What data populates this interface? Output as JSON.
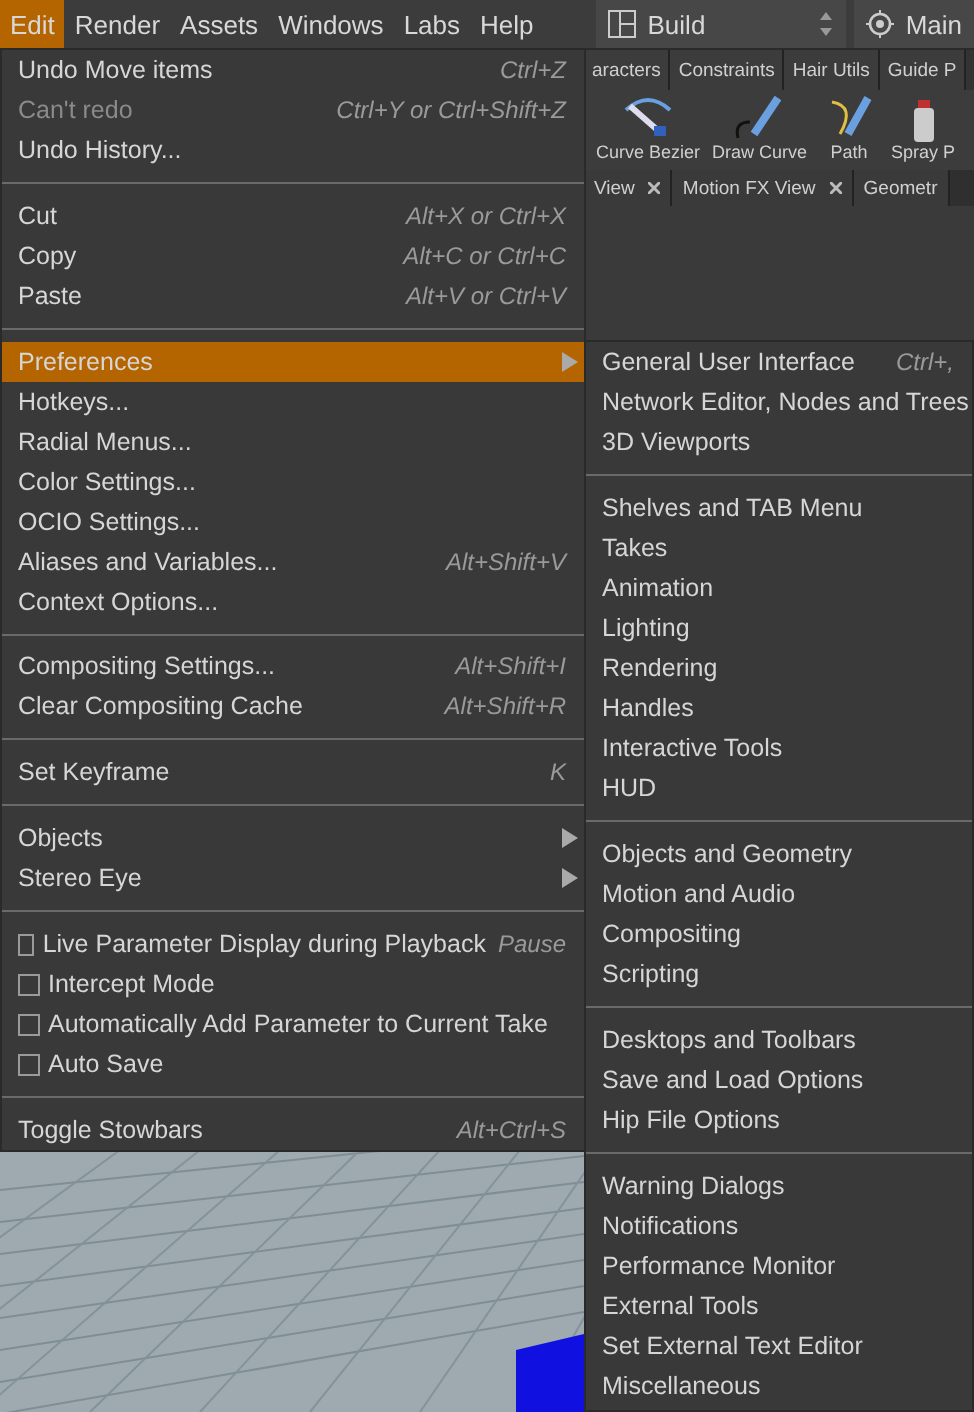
{
  "menubar": {
    "items": [
      {
        "label": "Edit",
        "selected": true
      },
      {
        "label": "Render",
        "selected": false
      },
      {
        "label": "Assets",
        "selected": false
      },
      {
        "label": "Windows",
        "selected": false
      },
      {
        "label": "Labs",
        "selected": false
      },
      {
        "label": "Help",
        "selected": false
      }
    ],
    "desktop": {
      "label": "Build"
    },
    "context": {
      "label": "Main"
    }
  },
  "shelf": {
    "tabs": [
      "aracters",
      "Constraints",
      "Hair Utils",
      "Guide P"
    ],
    "tools": [
      {
        "label": "Curve Bezier",
        "kind": "bezier"
      },
      {
        "label": "Draw Curve",
        "kind": "draw"
      },
      {
        "label": "Path",
        "kind": "path"
      },
      {
        "label": "Spray P",
        "kind": "spray"
      }
    ]
  },
  "pane_tabs": [
    {
      "label": "View",
      "closable": true
    },
    {
      "label": "Motion FX View",
      "closable": true
    },
    {
      "label": "Geometr",
      "closable": false
    }
  ],
  "edit_menu": {
    "sections": [
      [
        {
          "kind": "item",
          "label": "Undo Move items",
          "shortcut": "Ctrl+Z",
          "disabled": false,
          "selected": false
        },
        {
          "kind": "item",
          "label": "Can't redo",
          "shortcut": "Ctrl+Y or Ctrl+Shift+Z",
          "disabled": true,
          "selected": false
        },
        {
          "kind": "item",
          "label": "Undo History...",
          "disabled": false,
          "selected": false
        }
      ],
      [
        {
          "kind": "item",
          "label": "Cut",
          "shortcut": "Alt+X or Ctrl+X",
          "disabled": false,
          "selected": false
        },
        {
          "kind": "item",
          "label": "Copy",
          "shortcut": "Alt+C or Ctrl+C",
          "disabled": false,
          "selected": false
        },
        {
          "kind": "item",
          "label": "Paste",
          "shortcut": "Alt+V or Ctrl+V",
          "disabled": false,
          "selected": false
        }
      ],
      [
        {
          "kind": "submenu",
          "label": "Preferences",
          "disabled": false,
          "selected": true
        },
        {
          "kind": "item",
          "label": "Hotkeys...",
          "disabled": false,
          "selected": false
        },
        {
          "kind": "item",
          "label": "Radial Menus...",
          "disabled": false,
          "selected": false
        },
        {
          "kind": "item",
          "label": "Color Settings...",
          "disabled": false,
          "selected": false
        },
        {
          "kind": "item",
          "label": "OCIO Settings...",
          "disabled": false,
          "selected": false
        },
        {
          "kind": "item",
          "label": "Aliases and Variables...",
          "shortcut": "Alt+Shift+V",
          "disabled": false,
          "selected": false
        },
        {
          "kind": "item",
          "label": "Context Options...",
          "disabled": false,
          "selected": false
        }
      ],
      [
        {
          "kind": "item",
          "label": "Compositing Settings...",
          "shortcut": "Alt+Shift+I",
          "disabled": false,
          "selected": false
        },
        {
          "kind": "item",
          "label": "Clear Compositing Cache",
          "shortcut": "Alt+Shift+R",
          "disabled": false,
          "selected": false
        }
      ],
      [
        {
          "kind": "item",
          "label": "Set Keyframe",
          "shortcut": "K",
          "disabled": false,
          "selected": false
        }
      ],
      [
        {
          "kind": "submenu",
          "label": "Objects",
          "disabled": false,
          "selected": false
        },
        {
          "kind": "submenu",
          "label": "Stereo Eye",
          "disabled": false,
          "selected": false
        }
      ],
      [
        {
          "kind": "checkbox",
          "label": "Live Parameter Display during Playback",
          "shortcut": "Pause",
          "checked": false,
          "disabled": false,
          "selected": false
        },
        {
          "kind": "checkbox",
          "label": "Intercept Mode",
          "checked": false,
          "disabled": false,
          "selected": false
        },
        {
          "kind": "checkbox",
          "label": "Automatically Add Parameter to Current Take",
          "checked": false,
          "disabled": false,
          "selected": false
        },
        {
          "kind": "checkbox",
          "label": "Auto Save",
          "checked": false,
          "disabled": false,
          "selected": false
        }
      ],
      [
        {
          "kind": "item",
          "label": "Toggle Stowbars",
          "shortcut": "Alt+Ctrl+S",
          "disabled": false,
          "selected": false
        }
      ]
    ]
  },
  "preferences_submenu": {
    "sections": [
      [
        {
          "label": "General User Interface",
          "shortcut": "Ctrl+,"
        },
        {
          "label": "Network Editor, Nodes and Trees"
        },
        {
          "label": "3D Viewports"
        }
      ],
      [
        {
          "label": "Shelves and TAB Menu"
        },
        {
          "label": "Takes"
        },
        {
          "label": "Animation"
        },
        {
          "label": "Lighting"
        },
        {
          "label": "Rendering"
        },
        {
          "label": "Handles"
        },
        {
          "label": "Interactive Tools"
        },
        {
          "label": "HUD"
        }
      ],
      [
        {
          "label": "Objects and Geometry"
        },
        {
          "label": "Motion and Audio"
        },
        {
          "label": "Compositing"
        },
        {
          "label": "Scripting"
        }
      ],
      [
        {
          "label": "Desktops and Toolbars"
        },
        {
          "label": "Save and Load Options"
        },
        {
          "label": "Hip File Options"
        }
      ],
      [
        {
          "label": "Warning Dialogs"
        },
        {
          "label": "Notifications"
        },
        {
          "label": "Performance Monitor"
        },
        {
          "label": "External Tools"
        },
        {
          "label": "Set External Text Editor"
        },
        {
          "label": "Miscellaneous"
        }
      ]
    ]
  }
}
